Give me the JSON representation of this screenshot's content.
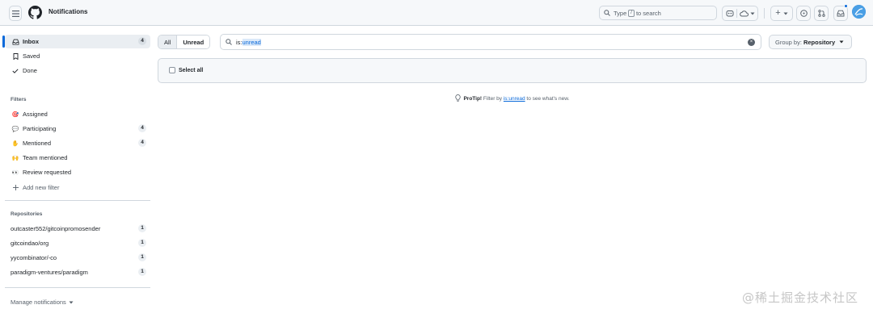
{
  "header": {
    "title": "Notifications",
    "search_prefix": "Type",
    "search_key": "/",
    "search_suffix": "to search",
    "plus_label": "+"
  },
  "sidebar": {
    "main_items": [
      {
        "label": "Inbox",
        "icon": "inbox-icon",
        "count": "4",
        "active": true
      },
      {
        "label": "Saved",
        "icon": "bookmark-icon"
      },
      {
        "label": "Done",
        "icon": "check-icon"
      }
    ],
    "filters_title": "Filters",
    "filters": [
      {
        "label": "Assigned",
        "emoji": "🎯"
      },
      {
        "label": "Participating",
        "emoji": "💬",
        "count": "4"
      },
      {
        "label": "Mentioned",
        "emoji": "✋",
        "count": "4"
      },
      {
        "label": "Team mentioned",
        "emoji": "🙌"
      },
      {
        "label": "Review requested",
        "emoji": "👀"
      }
    ],
    "add_filter": "Add new filter",
    "repos_title": "Repositories",
    "repos": [
      {
        "label": "outcaster552/gitcoinpromosender",
        "count": "1"
      },
      {
        "label": "gitcoindao/org",
        "count": "1"
      },
      {
        "label": "yycombinator/-co",
        "count": "1"
      },
      {
        "label": "paradigm-ventures/paradigm",
        "count": "1"
      }
    ],
    "manage": "Manage notifications"
  },
  "main": {
    "tabs": [
      {
        "label": "All"
      },
      {
        "label": "Unread"
      }
    ],
    "query_qualifier": "is:",
    "query_value": "unread",
    "group_by_label": "Group by:",
    "group_by_value": "Repository",
    "select_all": "Select all",
    "protip_label": "ProTip!",
    "protip_before": "Filter by",
    "protip_link": "is:unread",
    "protip_after": "to see what's new."
  },
  "watermark": "@稀土掘金技术社区",
  "colors": {
    "accent": "#0969da",
    "border": "#d0d7de",
    "header_bg": "#f6f8fa"
  }
}
